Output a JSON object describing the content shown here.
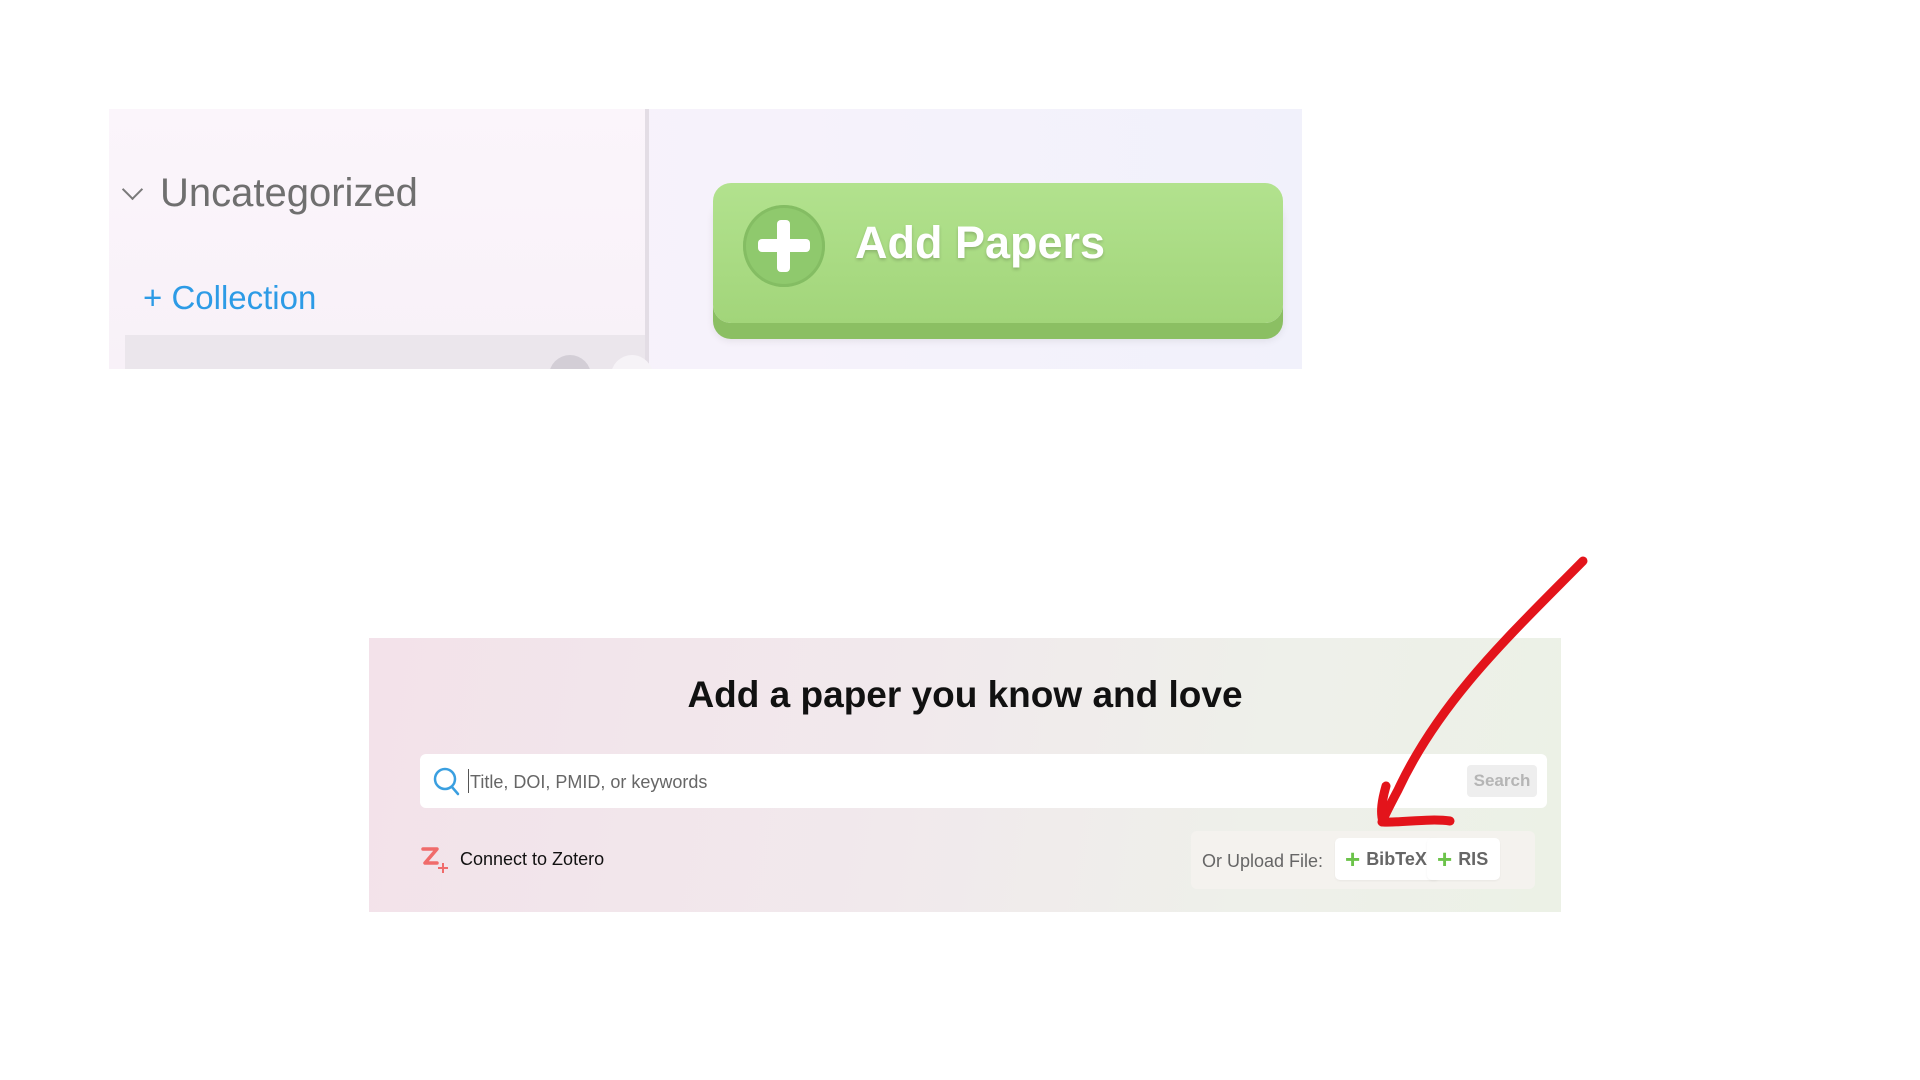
{
  "top_panel": {
    "category_label": "Uncategorized",
    "add_collection_label": "+ Collection",
    "add_papers_label": "Add Papers",
    "accent_color": "#a8dc82",
    "link_color": "#2d9be6"
  },
  "bottom_panel": {
    "title": "Add a paper you know and love",
    "search": {
      "placeholder": "Title, DOI, PMID, or keywords",
      "value": "",
      "button_label": "Search"
    },
    "zotero_label": "Connect to Zotero",
    "upload": {
      "label": "Or Upload File:",
      "bibtex_label": "BibTeX",
      "ris_label": "RIS"
    }
  },
  "annotation": {
    "arrow_color": "#e3141b"
  },
  "icons": [
    "chevron-down-icon",
    "plus-circle-icon",
    "search-icon",
    "zotero-icon",
    "plus-icon"
  ]
}
